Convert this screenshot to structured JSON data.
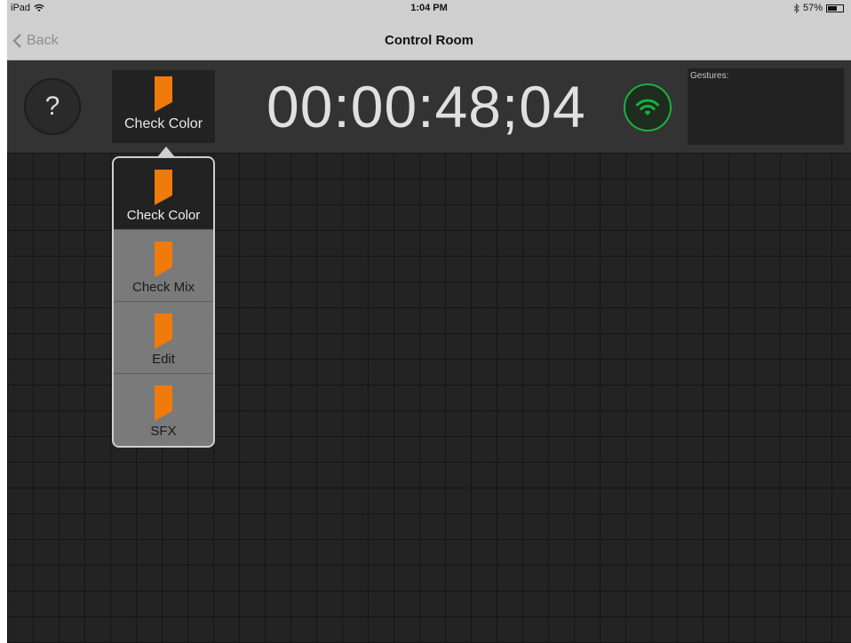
{
  "status_bar": {
    "device": "iPad",
    "wifi_icon": "wifi-icon",
    "time": "1:04 PM",
    "bluetooth_icon": "bluetooth-icon",
    "battery": "57%",
    "battery_level": 0.57
  },
  "nav": {
    "back_label": "Back",
    "title": "Control Room"
  },
  "toolbar": {
    "help_label": "?",
    "current_bookmark": "Check Color",
    "timecode": "00:00:48;04",
    "connection_status_color": "#16b33b",
    "gestures_label": "Gestures:"
  },
  "bookmark_menu": {
    "items": [
      {
        "label": "Check Color",
        "selected": true
      },
      {
        "label": "Check Mix",
        "selected": false
      },
      {
        "label": "Edit",
        "selected": false
      },
      {
        "label": "SFX",
        "selected": false
      }
    ]
  },
  "colors": {
    "flag": "#f07a0a",
    "accent_green": "#16b33b"
  }
}
